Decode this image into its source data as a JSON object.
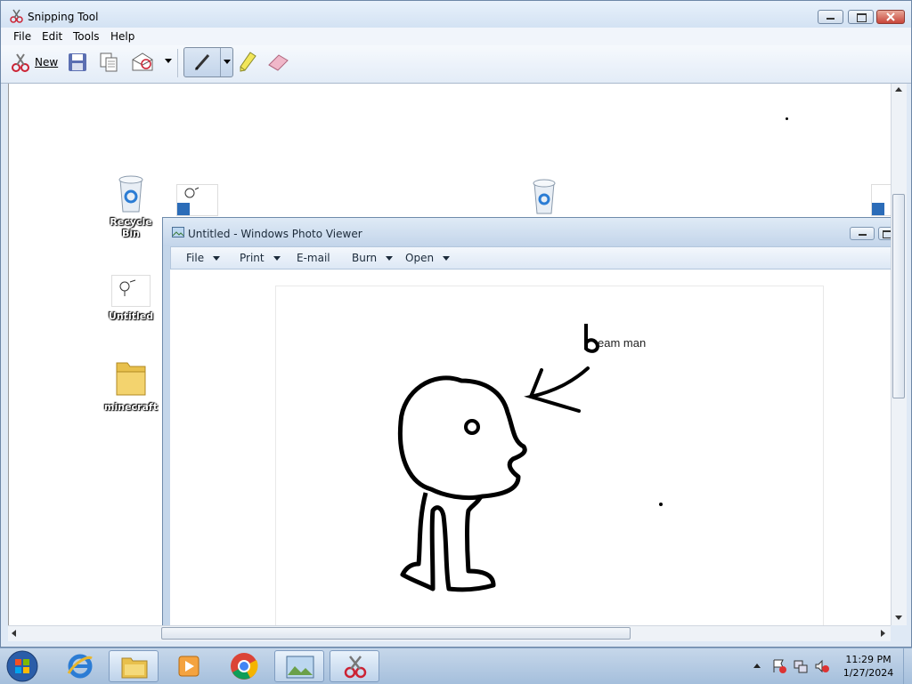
{
  "window": {
    "title": "Snipping Tool"
  },
  "menubar": {
    "items": [
      "File",
      "Edit",
      "Tools",
      "Help"
    ]
  },
  "toolbar": {
    "new_label": "New"
  },
  "desktop_icons": [
    {
      "label": "Recycle Bin"
    },
    {
      "label": "Untitled"
    },
    {
      "label": "minecraft"
    }
  ],
  "photo_viewer": {
    "title": "Untitled - Windows Photo Viewer",
    "menu": [
      "File",
      "Print",
      "E-mail",
      "Burn",
      "Open"
    ]
  },
  "drawing": {
    "annotation": "eam man"
  },
  "taskbar": {
    "time": "11:29 PM",
    "date": "1/27/2024"
  },
  "colors": {
    "accent": "#3a6ea5",
    "title_bg": "#d3e2f3",
    "close_red": "#c8453a"
  }
}
